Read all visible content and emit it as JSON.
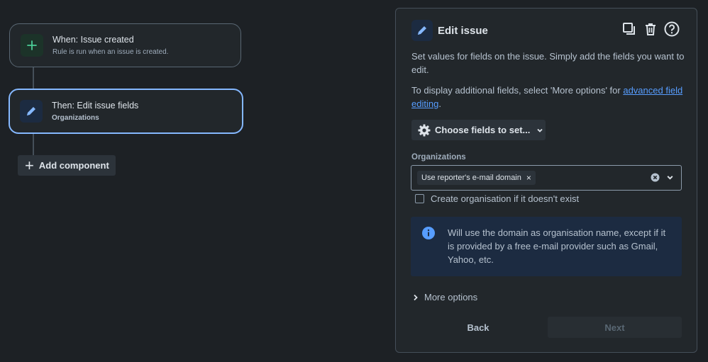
{
  "flow": {
    "trigger": {
      "title": "When: Issue created",
      "subtitle": "Rule is run when an issue is created.",
      "icon": "plus-icon"
    },
    "action": {
      "title": "Then: Edit issue fields",
      "subtitle": "Organizations",
      "icon": "pencil-icon"
    },
    "add_component_label": "Add component"
  },
  "panel": {
    "title": "Edit issue",
    "icons": [
      "copy-icon",
      "trash-icon",
      "help-icon"
    ],
    "description": "Set values for fields on the issue. Simply add the fields you want to edit.",
    "additional_prefix": "To display additional fields, select 'More options' for ",
    "additional_link": "advanced field editing",
    "additional_suffix": ".",
    "choose_fields_label": "Choose fields to set...",
    "organizations": {
      "label": "Organizations",
      "selected_tag": "Use reporter's e-mail domain"
    },
    "create_org_checkbox": {
      "label": "Create organisation if it doesn't exist",
      "checked": false
    },
    "info_message": "Will use the domain as organisation name, except if it is provided by a free e-mail provider such as Gmail, Yahoo, etc.",
    "more_options_label": "More options",
    "back_label": "Back",
    "next_label": "Next"
  },
  "colors": {
    "background": "#1d2125",
    "accent": "#85b8ff",
    "link": "#579dff",
    "success": "#4bce97",
    "info_bg": "#1c2b41"
  }
}
